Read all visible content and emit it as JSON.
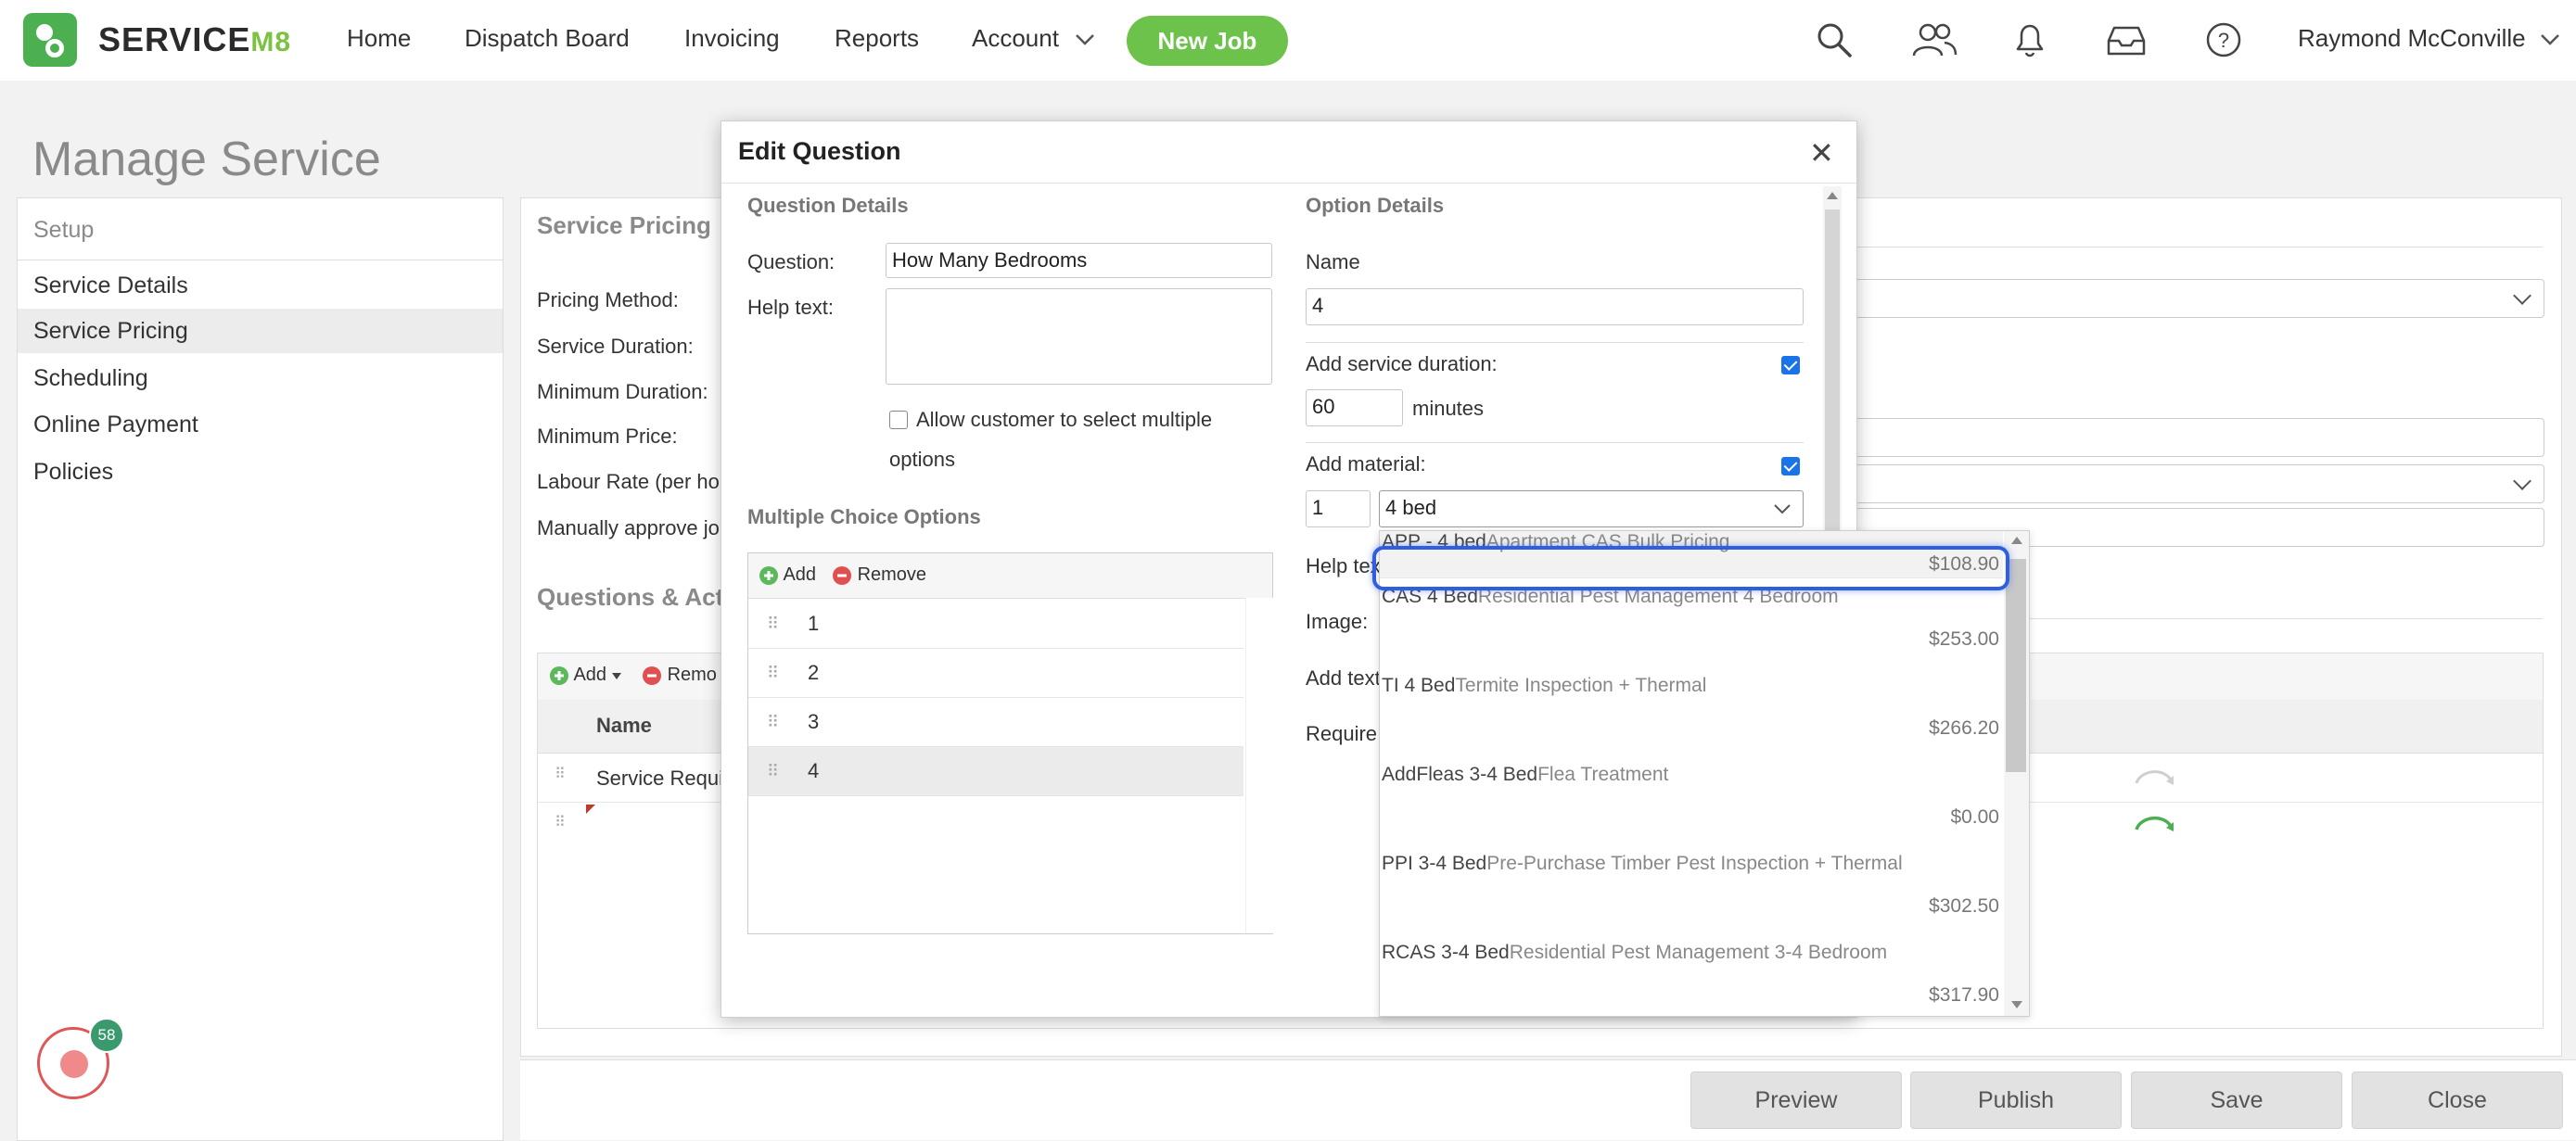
{
  "nav": {
    "logo_main": "SERVICE",
    "logo_suffix": "M8",
    "items": [
      "Home",
      "Dispatch Board",
      "Invoicing",
      "Reports",
      "Account"
    ],
    "new_job": "New Job",
    "user": "Raymond McConville"
  },
  "page": {
    "title": "Manage Service"
  },
  "setup": {
    "header": "Setup",
    "items": [
      "Service Details",
      "Service Pricing",
      "Scheduling",
      "Online Payment",
      "Policies"
    ]
  },
  "notifications": {
    "count": "58"
  },
  "main": {
    "service_pricing_head": "Service Pricing",
    "labels": [
      "Pricing Method:",
      "Service Duration:",
      "Minimum Duration:",
      "Minimum Price:",
      "Labour Rate (per hou",
      "Manually approve jo"
    ],
    "qa_head": "Questions & Actio",
    "add_label": "Add",
    "remove_label": "Remo",
    "name_col": "Name",
    "row1": "Service Requi"
  },
  "bottom": {
    "preview": "Preview",
    "publish": "Publish",
    "save": "Save",
    "close": "Close"
  },
  "modal": {
    "title": "Edit Question",
    "close": "✕",
    "question_details": {
      "head": "Question Details",
      "question_label": "Question:",
      "question_value": "How Many Bedrooms",
      "help_label": "Help text:",
      "help_value": "",
      "allow_multiple_line1": "Allow customer to select multiple",
      "allow_multiple_line2": "options"
    },
    "multiple_choice": {
      "head": "Multiple Choice Options",
      "add": "Add",
      "remove": "Remove",
      "options": [
        "1",
        "2",
        "3",
        "4"
      ]
    },
    "option_details": {
      "head": "Option Details",
      "name_label": "Name",
      "name_value": "4",
      "duration_label": "Add service duration:",
      "duration_value": "60",
      "duration_unit": "minutes",
      "material_label": "Add material:",
      "material_qty": "1",
      "material_value": "4 bed",
      "help_label": "Help tex",
      "image_label": "Image:",
      "add_text_label": "Add text",
      "require_label": "Require"
    }
  },
  "dropdown": {
    "items": [
      {
        "code": "APP - 4 bed",
        "desc": "Apartment CAS Bulk Pricing",
        "price": "$108.90"
      },
      {
        "code": "CAS 4 Bed",
        "desc": "Residential Pest Management 4 Bedroom",
        "price": "$253.00"
      },
      {
        "code": "TI 4 Bed",
        "desc": "Termite Inspection + Thermal",
        "price": "$266.20"
      },
      {
        "code": "AddFleas 3-4 Bed",
        "desc": "Flea Treatment",
        "price": "$0.00"
      },
      {
        "code": "PPI 3-4 Bed",
        "desc": "Pre-Purchase Timber Pest Inspection + Thermal",
        "price": "$302.50"
      },
      {
        "code": "RCAS 3-4 Bed",
        "desc": "Residential Pest Management 3-4 Bedroom",
        "price": "$317.90"
      }
    ]
  },
  "colors": {
    "brand_green": "#6cc24a",
    "focus_blue": "#2f5fe0",
    "checkbox_blue": "#1a73e8"
  }
}
